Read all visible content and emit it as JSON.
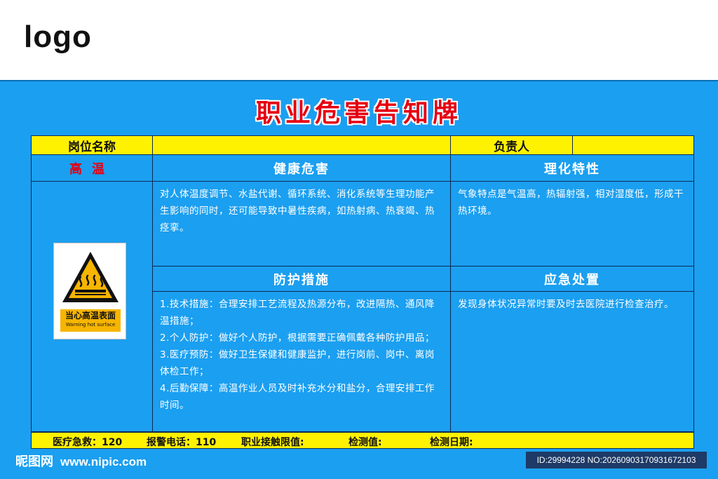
{
  "header": {
    "logo_text": "logo"
  },
  "title": "职业危害告知牌",
  "table": {
    "post_name_label": "岗位名称",
    "post_name_value": "",
    "responsible_label": "负责人",
    "responsible_value": "",
    "hazard_name": "高温",
    "health_hazard": {
      "heading": "健康危害",
      "text": "对人体温度调节、水盐代谢、循环系统、消化系统等生理功能产生影响的同时，还可能导致中暑性疾病，如热射病、热衰竭、热痉挛。"
    },
    "physchem": {
      "heading": "理化特性",
      "text": "气象特点是气温高，热辐射强，相对湿度低，形成干热环境。"
    },
    "protection": {
      "heading": "防护措施",
      "items": [
        "1.技术措施：合理安排工艺流程及热源分布，改进隔热、通风降温措施；",
        "2.个人防护：做好个人防护，根据需要正确佩戴各种防护用品；",
        "3.医疗预防：做好卫生保健和健康监护，进行岗前、岗中、离岗体检工作；",
        "4.后勤保障：高温作业人员及时补充水分和盐分，合理安排工作时间。"
      ]
    },
    "emergency": {
      "heading": "应急处置",
      "text": "发现身体状况异常时要及时去医院进行检查治疗。"
    },
    "sign": {
      "label_cn": "当心高温表面",
      "label_en": "Warning hot surface",
      "icon": "hot-surface-warning-icon"
    }
  },
  "footer": {
    "medical": "医疗急救：120",
    "police": "报警电话：110",
    "limit": "职业接触限值:",
    "measured": "检测值:",
    "date": "检测日期:"
  },
  "watermark": {
    "site_name": "昵图网",
    "url": "www.nipic.com",
    "id_text": "ID:29994228 NO:20260903170931672103"
  },
  "colors": {
    "background": "#1b9ff0",
    "yellow": "#fff200",
    "title_red": "#e60012",
    "border": "#0b2a55"
  }
}
